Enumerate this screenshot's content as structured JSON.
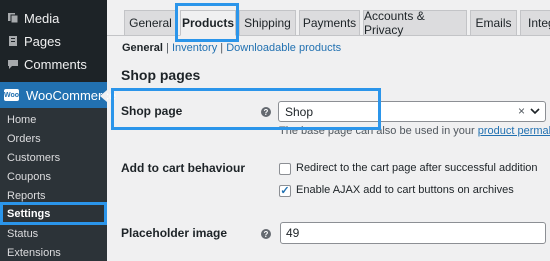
{
  "sidebar": {
    "top_items": [
      {
        "label": "Media",
        "icon": "media-icon"
      },
      {
        "label": "Pages",
        "icon": "pages-icon"
      },
      {
        "label": "Comments",
        "icon": "comments-icon"
      }
    ],
    "woocommerce": {
      "label": "WooCommerce",
      "badge": "Woo"
    },
    "submenu": [
      {
        "label": "Home"
      },
      {
        "label": "Orders"
      },
      {
        "label": "Customers"
      },
      {
        "label": "Coupons"
      },
      {
        "label": "Reports"
      },
      {
        "label": "Settings",
        "active": true
      },
      {
        "label": "Status"
      },
      {
        "label": "Extensions"
      }
    ]
  },
  "tabs": [
    {
      "label": "General"
    },
    {
      "label": "Products",
      "active": true
    },
    {
      "label": "Shipping"
    },
    {
      "label": "Payments"
    },
    {
      "label": "Accounts & Privacy"
    },
    {
      "label": "Emails"
    },
    {
      "label": "Integ"
    }
  ],
  "subsections": {
    "current": "General",
    "separator": " | ",
    "links": [
      "Inventory",
      "Downloadable products"
    ]
  },
  "section_title": "Shop pages",
  "shop_page": {
    "label": "Shop page",
    "help": "?",
    "value": "Shop",
    "clear": "×",
    "description_prefix": "The base page can also be used in your ",
    "description_link": "product permalinks",
    "description_suffix": "."
  },
  "add_to_cart": {
    "label": "Add to cart behaviour",
    "options": [
      {
        "label": "Redirect to the cart page after successful addition",
        "checked": false
      },
      {
        "label": "Enable AJAX add to cart buttons on archives",
        "checked": true
      }
    ]
  },
  "placeholder_image": {
    "label": "Placeholder image",
    "help": "?",
    "value": "49"
  },
  "colors": {
    "sidebar_bg": "#1d2327",
    "active_menu": "#2271b1",
    "highlight_box": "#2b95ea",
    "link": "#2271b1"
  }
}
